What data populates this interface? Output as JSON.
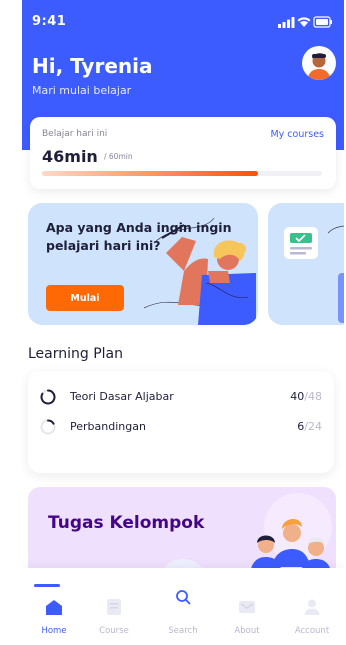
{
  "status": {
    "time": "9:41"
  },
  "header": {
    "greeting": "Hi, Tyrenia",
    "subtitle": "Mari mulai belajar"
  },
  "progress_card": {
    "label": "Belajar hari ini",
    "link": "My courses",
    "value": "46min",
    "total": "/ 60min",
    "progress_fraction": 0.77
  },
  "promo": {
    "title": "Apa yang Anda ingin ingin pelajari hari ini?",
    "button": "Mulai"
  },
  "learning_plan": {
    "title": "Learning Plan",
    "items": [
      {
        "name": "Teori Dasar Aljabar",
        "done": "40",
        "total": "/48"
      },
      {
        "name": "Perbandingan",
        "done": "6",
        "total": "/24"
      }
    ]
  },
  "group": {
    "title": "Tugas Kelompok"
  },
  "nav": [
    {
      "label": "Home",
      "icon": "home-icon",
      "active": true
    },
    {
      "label": "Course",
      "icon": "book-icon",
      "active": false
    },
    {
      "label": "Search",
      "icon": "search-icon",
      "active": false
    },
    {
      "label": "About",
      "icon": "message-icon",
      "active": false
    },
    {
      "label": "Account",
      "icon": "user-icon",
      "active": false
    }
  ],
  "colors": {
    "primary": "#3d5cff",
    "accent": "#ff6905",
    "muted": "#b8b8d2",
    "group_title": "#440687"
  }
}
